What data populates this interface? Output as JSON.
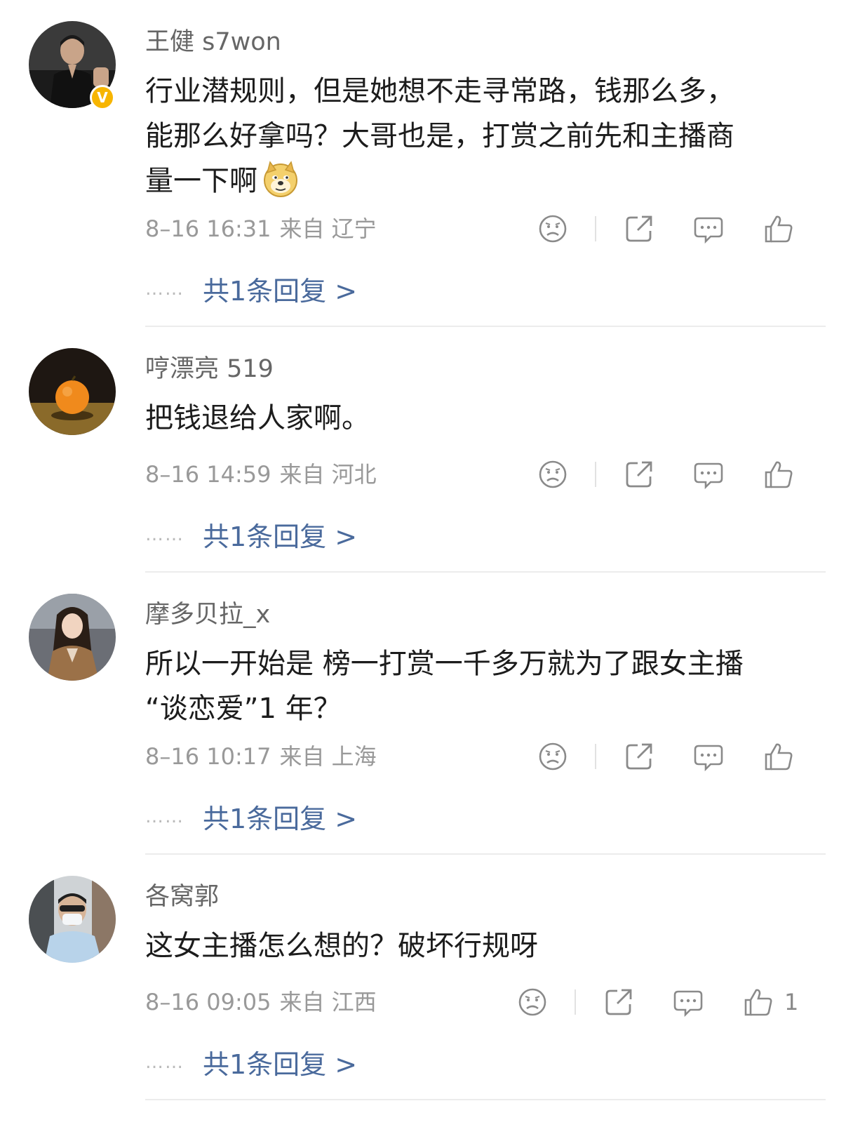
{
  "comments": [
    {
      "username": "王健 s7won",
      "text_line1": "行业潜规则，但是她想不走寻常路，钱那么多，",
      "text_line2": "能那么好拿吗？大哥也是，打赏之前先和主播商",
      "text_line3": "量一下啊",
      "emoji": "doge-emoji",
      "verified_badge": "V",
      "date": "8–16 16:31",
      "source": "来自 辽宁",
      "like_count": "",
      "replies": "共1条回复 >"
    },
    {
      "username": "哼漂亮 519",
      "text_line1": "把钱退给人家啊。",
      "date": "8–16 14:59",
      "source": "来自 河北",
      "like_count": "",
      "replies": "共1条回复 >"
    },
    {
      "username": "摩多贝拉_x",
      "text_line1": "所以一开始是 榜一打赏一千多万就为了跟女主播",
      "text_line2": "“谈恋爱”1 年？",
      "date": "8–16 10:17",
      "source": "来自 上海",
      "like_count": "",
      "replies": "共1条回复 >"
    },
    {
      "username": "各窝郭",
      "text_line1": "这女主播怎么想的？破坏行规呀",
      "date": "8–16 09:05",
      "source": "来自 江西",
      "like_count": "1",
      "replies": "共1条回复 >"
    }
  ],
  "dots": "……",
  "colors": {
    "link": "#4a6a9c",
    "meta": "#999999",
    "badge": "#f7b500"
  },
  "icons": [
    "dislike-face-icon",
    "share-icon",
    "comment-icon",
    "like-thumb-icon"
  ]
}
